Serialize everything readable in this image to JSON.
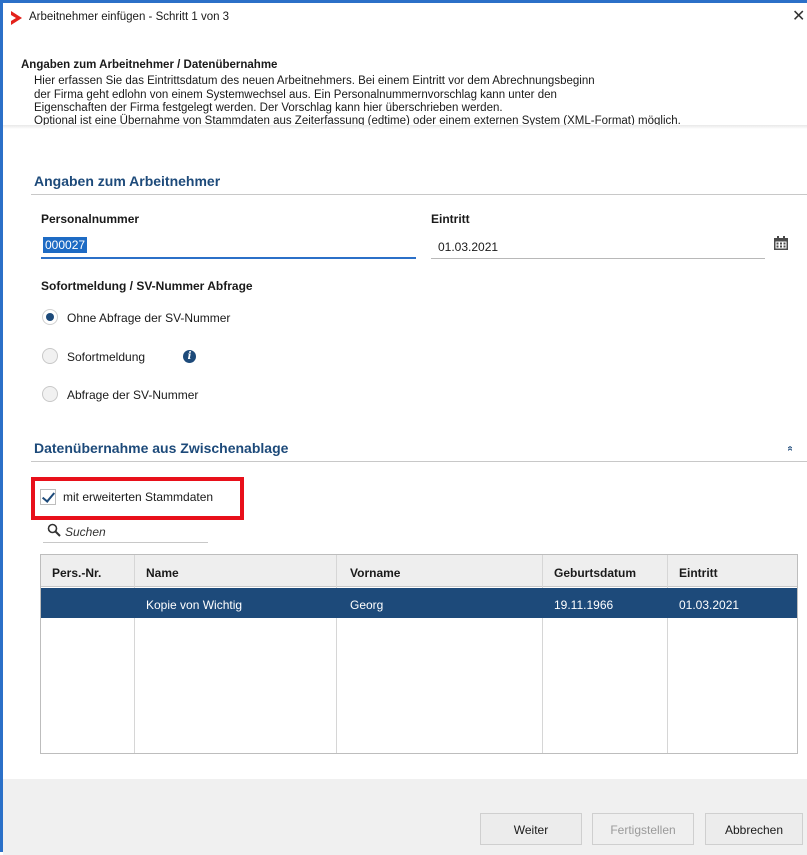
{
  "window": {
    "title": "Arbeitnehmer einfügen - Schritt 1 von 3",
    "close_glyph": "✕"
  },
  "info": {
    "title": "Angaben zum Arbeitnehmer / Datenübernahme",
    "lines": [
      "Hier erfassen Sie das Eintrittsdatum des neuen Arbeitnehmers. Bei einem Eintritt vor dem Abrechnungsbeginn",
      "der Firma geht edlohn von einem Systemwechsel aus. Ein Personalnummernvorschlag kann unter den",
      "Eigenschaften der Firma festgelegt werden. Der Vorschlag kann hier überschrieben werden.",
      "Optional ist eine Übernahme von Stammdaten aus Zeiterfassung (edtime) oder einem externen System (XML-Format) möglich."
    ]
  },
  "employee": {
    "section_title": "Angaben zum Arbeitnehmer",
    "personalnummer_label": "Personalnummer",
    "personalnummer_value": "000027",
    "eintritt_label": "Eintritt",
    "eintritt_value": "01.03.2021",
    "sv_label": "Sofortmeldung / SV-Nummer Abfrage",
    "options": [
      {
        "label": "Ohne Abfrage der SV-Nummer",
        "selected": true
      },
      {
        "label": "Sofortmeldung",
        "selected": false
      },
      {
        "label": "Abfrage der SV-Nummer",
        "selected": false
      }
    ],
    "info_glyph": "i"
  },
  "import": {
    "section_title": "Datenübernahme aus Zwischenablage",
    "collapse_glyph": "»",
    "checkbox_label": "mit erweiterten Stammdaten",
    "checkbox_checked": true,
    "search_placeholder": "Suchen",
    "columns": [
      "Pers.-Nr.",
      "Name",
      "Vorname",
      "Geburtsdatum",
      "Eintritt"
    ],
    "rows": [
      {
        "persnr": "",
        "name": "Kopie von Wichtig",
        "vorname": "Georg",
        "geburtsdatum": "19.11.1966",
        "eintritt": "01.03.2021"
      }
    ]
  },
  "footer": {
    "weiter": "Weiter",
    "fertigstellen": "Fertigstellen",
    "abbrechen": "Abbrechen"
  },
  "colors": {
    "accent": "#1d4a7a",
    "window_border": "#2b70c8",
    "highlight_box": "#e8101a",
    "logo": "#e3221b"
  },
  "icons": {
    "logo": "red-arrow-logo",
    "close": "close-icon",
    "calendar": "calendar-icon",
    "info": "info-icon",
    "collapse": "double-chevron-up-icon",
    "search": "magnifier-icon",
    "check": "check-icon"
  }
}
